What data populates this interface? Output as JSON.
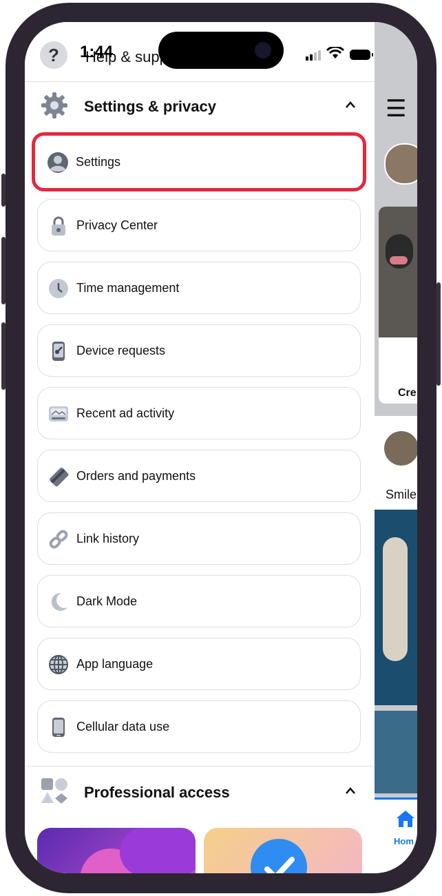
{
  "status_bar": {
    "time": "1:44"
  },
  "help": {
    "label": "Help & support"
  },
  "settings_section": {
    "title": "Settings & privacy",
    "chevron": "^",
    "items": [
      {
        "label": "Settings",
        "icon": "profile-icon"
      },
      {
        "label": "Privacy Center",
        "icon": "lock-icon"
      },
      {
        "label": "Time management",
        "icon": "clock-icon"
      },
      {
        "label": "Device requests",
        "icon": "phone-key-icon"
      },
      {
        "label": "Recent ad activity",
        "icon": "ad-activity-icon"
      },
      {
        "label": "Orders and payments",
        "icon": "card-icon"
      },
      {
        "label": "Link history",
        "icon": "link-icon"
      },
      {
        "label": "Dark Mode",
        "icon": "moon-icon"
      },
      {
        "label": "App language",
        "icon": "globe-icon"
      },
      {
        "label": "Cellular data use",
        "icon": "phone-icon"
      }
    ]
  },
  "professional_section": {
    "title": "Professional access",
    "chevron": "^"
  },
  "background_feed": {
    "create_label": "Cre",
    "smile_label": "Smile",
    "home_label": "Hom"
  },
  "colors": {
    "highlight": "#e2283f",
    "accent_blue": "#1877f2"
  }
}
